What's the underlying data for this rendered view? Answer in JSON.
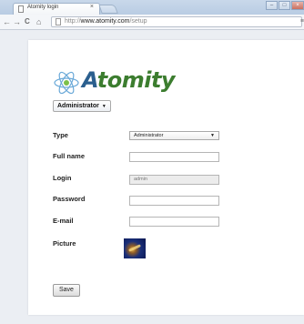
{
  "browser": {
    "tab_title": "Atomity login",
    "tab_close": "×",
    "url_scheme": "http://",
    "url_host": "www.atomity.com",
    "url_path": "/setup",
    "nav": {
      "back": "←",
      "forward": "→",
      "reload": "C",
      "home": "⌂"
    },
    "menu_glyph": "≡",
    "window_controls": {
      "minimize": "–",
      "maximize": "□",
      "close": "×"
    }
  },
  "page": {
    "brand": {
      "first_letter": "A",
      "rest": "tomity"
    },
    "role_selector": {
      "value": "Administrator",
      "arrow": "▼"
    },
    "form": {
      "type_label": "Type",
      "type_value": "Administrator",
      "type_arrow": "▼",
      "fullname_label": "Full name",
      "fullname_value": "",
      "login_label": "Login",
      "login_value": "admin",
      "password_label": "Password",
      "password_value": "",
      "email_label": "E-mail",
      "email_value": "",
      "picture_label": "Picture"
    },
    "save_label": "Save"
  },
  "colors": {
    "brand_blue": "#2b5f8e",
    "brand_green": "#3c7d2f",
    "page_background": "#ebeef3"
  },
  "icons": {
    "logo": "atom-icon",
    "tab_favicon": "page-icon",
    "omnibox_page": "page-icon",
    "menu": "menu-icon"
  }
}
